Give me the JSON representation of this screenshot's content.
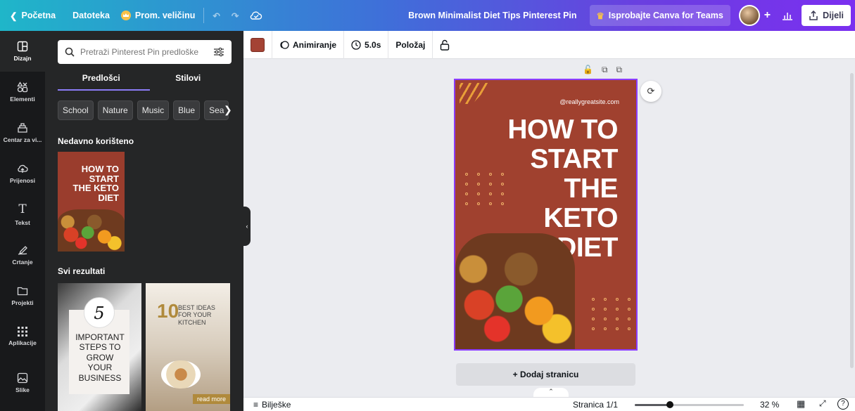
{
  "topbar": {
    "home": "Početna",
    "file": "Datoteka",
    "resize": "Prom. veličinu",
    "doc_title": "Brown Minimalist Diet Tips Pinterest Pin",
    "teams": "Isprobajte Canva for Teams",
    "plus": "+",
    "share": "Dijeli"
  },
  "rail": [
    {
      "label": "Dizajn",
      "icon": "layout-icon"
    },
    {
      "label": "Elementi",
      "icon": "shapes-icon"
    },
    {
      "label": "Centar za vi...",
      "icon": "brand-icon"
    },
    {
      "label": "Prijenosi",
      "icon": "upload-cloud-icon"
    },
    {
      "label": "Tekst",
      "icon": "text-icon"
    },
    {
      "label": "Crtanje",
      "icon": "draw-icon"
    },
    {
      "label": "Projekti",
      "icon": "folder-icon"
    },
    {
      "label": "Aplikacije",
      "icon": "apps-grid-icon"
    },
    {
      "label": "Slike",
      "icon": "image-icon"
    }
  ],
  "panel": {
    "search_placeholder": "Pretraži Pinterest Pin predloške",
    "tabs": [
      "Predlošci",
      "Stilovi"
    ],
    "chips": [
      "School",
      "Nature",
      "Music",
      "Blue",
      "Sea"
    ],
    "recent_heading": "Nedavno korišteno",
    "all_heading": "Svi rezultati",
    "recent_thumb_title": "HOW TO START THE KETO DIET",
    "result1_number": "5",
    "result1_text": "IMPORTANT STEPS TO GROW YOUR BUSINESS",
    "result2_number": "10",
    "result2_text": "BEST IDEAS FOR YOUR KITCHEN",
    "result2_more": "read more"
  },
  "toolbar": {
    "color": "#a44334",
    "animate": "Animiranje",
    "duration": "5.0s",
    "position": "Položaj"
  },
  "design": {
    "site": "@reallygreatsite.com",
    "lines": [
      "HOW TO",
      "START",
      "THE",
      "KETO",
      "DIET"
    ],
    "bg": "#a0412f"
  },
  "canvas": {
    "add_page": "+ Dodaj stranicu"
  },
  "bottom": {
    "notes": "Bilješke",
    "page": "Stranica 1/1",
    "zoom": "32 %",
    "zoom_value": 32
  }
}
